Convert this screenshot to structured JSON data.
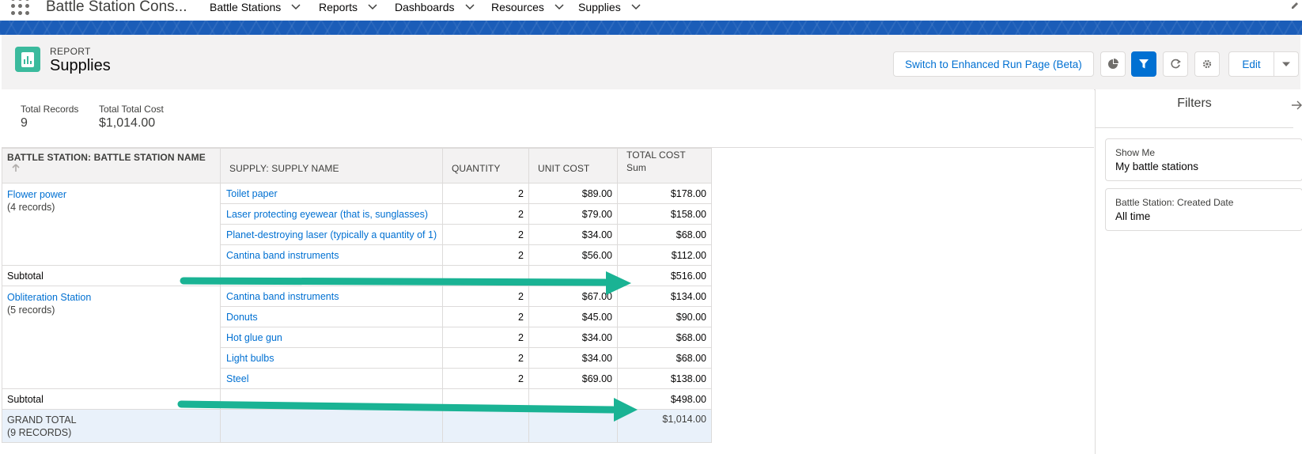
{
  "topnav": {
    "app_name": "Battle Station Cons...",
    "items": [
      "Battle Stations",
      "Reports",
      "Dashboards",
      "Resources",
      "Supplies"
    ]
  },
  "header": {
    "object_type": "REPORT",
    "title": "Supplies",
    "switch_button": "Switch to Enhanced Run Page (Beta)",
    "edit_button": "Edit",
    "icons": [
      "chart-icon",
      "filter-icon",
      "refresh-icon",
      "gear-icon",
      "chevron-down-icon"
    ]
  },
  "summary": {
    "total_records_label": "Total Records",
    "total_records_value": "9",
    "total_cost_label": "Total Total Cost",
    "total_cost_value": "$1,014.00"
  },
  "table": {
    "columns": {
      "group": "BATTLE STATION: BATTLE STATION NAME",
      "supply": "SUPPLY: SUPPLY NAME",
      "quantity": "QUANTITY",
      "unit_cost": "UNIT COST",
      "total_cost": "TOTAL COST",
      "total_cost_sub": "Sum"
    },
    "groups": [
      {
        "name": "Flower power",
        "count": "(4 records)",
        "rows": [
          {
            "supply": "Toilet paper",
            "quantity": "2",
            "unit_cost": "$89.00",
            "total_cost": "$178.00"
          },
          {
            "supply": "Laser protecting eyewear (that is, sunglasses)",
            "quantity": "2",
            "unit_cost": "$79.00",
            "total_cost": "$158.00"
          },
          {
            "supply": "Planet-destroying laser (typically a quantity of 1)",
            "quantity": "2",
            "unit_cost": "$34.00",
            "total_cost": "$68.00"
          },
          {
            "supply": "Cantina band instruments",
            "quantity": "2",
            "unit_cost": "$56.00",
            "total_cost": "$112.00"
          }
        ],
        "subtotal_label": "Subtotal",
        "subtotal": "$516.00"
      },
      {
        "name": "Obliteration Station",
        "count": "(5 records)",
        "rows": [
          {
            "supply": "Cantina band instruments",
            "quantity": "2",
            "unit_cost": "$67.00",
            "total_cost": "$134.00"
          },
          {
            "supply": "Donuts",
            "quantity": "2",
            "unit_cost": "$45.00",
            "total_cost": "$90.00"
          },
          {
            "supply": "Hot glue gun",
            "quantity": "2",
            "unit_cost": "$34.00",
            "total_cost": "$68.00"
          },
          {
            "supply": "Light bulbs",
            "quantity": "2",
            "unit_cost": "$34.00",
            "total_cost": "$68.00"
          },
          {
            "supply": "Steel",
            "quantity": "2",
            "unit_cost": "$69.00",
            "total_cost": "$138.00"
          }
        ],
        "subtotal_label": "Subtotal",
        "subtotal": "$498.00"
      }
    ],
    "grand_total_label": "GRAND TOTAL",
    "grand_total_count": "(9 RECORDS)",
    "grand_total": "$1,014.00"
  },
  "filters": {
    "title": "Filters",
    "cards": [
      {
        "label": "Show Me",
        "value": "My battle stations"
      },
      {
        "label": "Battle Station: Created Date",
        "value": "All time"
      }
    ]
  },
  "colors": {
    "brand_blue": "#0070d2",
    "band_blue": "#1b5db8",
    "report_icon": "#3bba9d",
    "annotation_arrow": "#1ab394"
  }
}
